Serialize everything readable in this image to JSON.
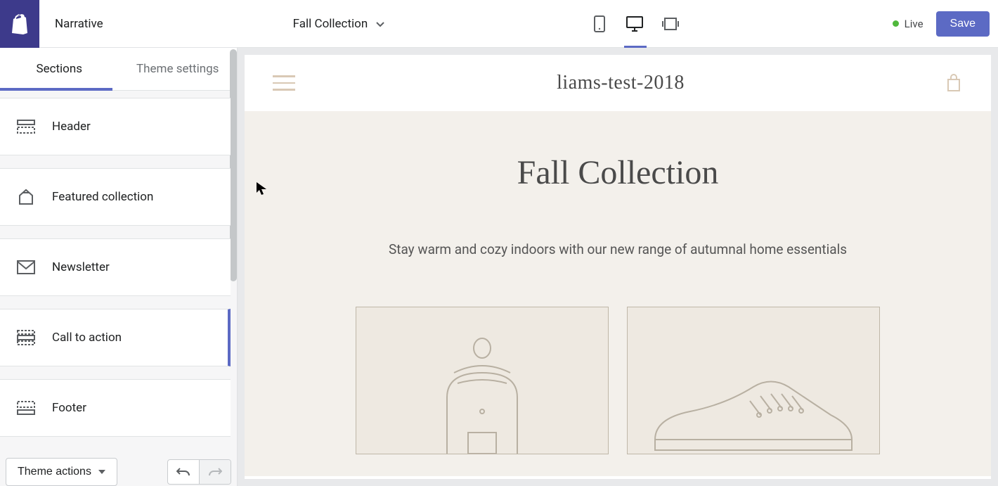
{
  "header": {
    "theme_name": "Narrative",
    "page_selector": "Fall Collection",
    "live_label": "Live",
    "save_label": "Save"
  },
  "sidebar": {
    "tabs": {
      "sections": "Sections",
      "theme_settings": "Theme settings"
    },
    "items": [
      {
        "label": "Header"
      },
      {
        "label": "Featured collection"
      },
      {
        "label": "Newsletter"
      },
      {
        "label": "Call to action"
      },
      {
        "label": "Footer"
      }
    ],
    "footer": {
      "theme_actions": "Theme actions"
    }
  },
  "preview": {
    "store_name": "liams-test-2018",
    "collection_title": "Fall Collection",
    "collection_desc": "Stay warm and cozy indoors with our new range of autumnal home essentials"
  }
}
